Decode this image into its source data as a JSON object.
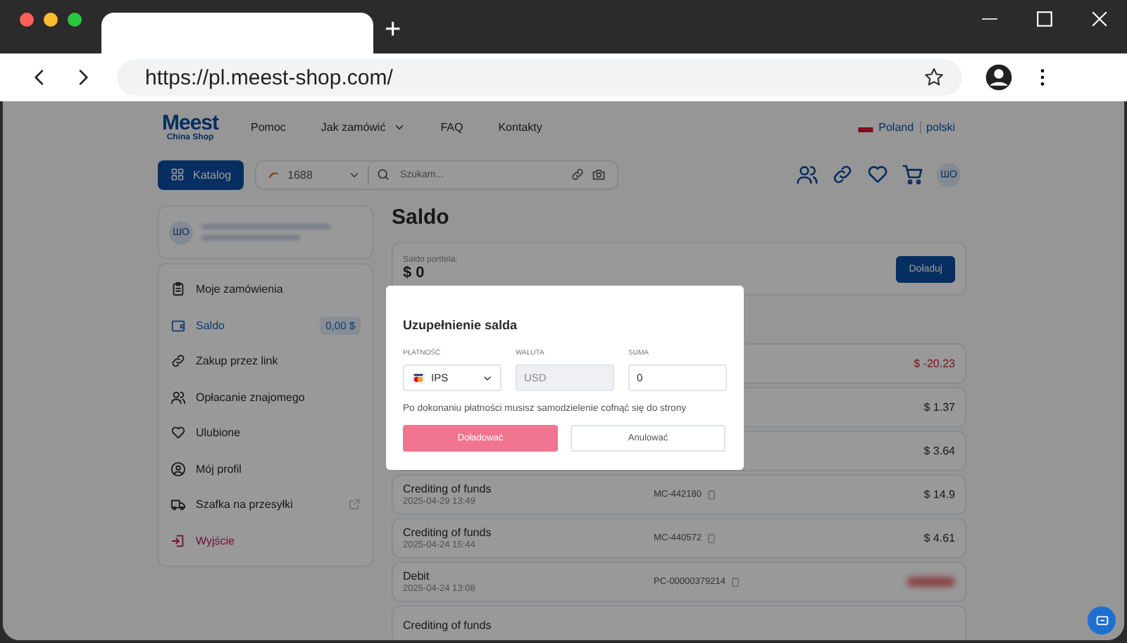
{
  "browser": {
    "new_tab": "+",
    "url": "https://pl.meest-shop.com/"
  },
  "header": {
    "logo": "Meest",
    "logo_sub": "China Shop",
    "nav": [
      {
        "label": "Pomoc",
        "dropdown": false
      },
      {
        "label": "Jak zamówić",
        "dropdown": true
      },
      {
        "label": "FAQ",
        "dropdown": false
      },
      {
        "label": "Kontakty",
        "dropdown": false
      }
    ],
    "country": "Poland",
    "language": "polski",
    "catalog_button": "Katalog",
    "source": "1688",
    "search": {
      "placeholder": "Szukam..."
    },
    "avatar": "ШО"
  },
  "sidebar": {
    "avatar": "ШО",
    "items": [
      {
        "label": "Moje zamówienia",
        "selected": false,
        "kind": "normal"
      },
      {
        "label": "Saldo",
        "selected": true,
        "kind": "normal",
        "badge": "0,00 $"
      },
      {
        "label": "Zakup przez link",
        "selected": false,
        "kind": "normal"
      },
      {
        "label": "Opłacanie znajomego",
        "selected": false,
        "kind": "normal"
      },
      {
        "label": "Ulubione",
        "selected": false,
        "kind": "normal"
      },
      {
        "label": "Mój profil",
        "selected": false,
        "kind": "normal"
      },
      {
        "label": "Szafka na przesyłki",
        "selected": false,
        "kind": "external"
      },
      {
        "label": "Wyjście",
        "selected": false,
        "kind": "logout"
      }
    ]
  },
  "main": {
    "title": "Saldo",
    "wallet": {
      "label": "Saldo portfela:",
      "amount": "$ 0",
      "button": "Doładuj"
    },
    "transactions": [
      {
        "kind": "debit",
        "amount": "$ -20.23"
      },
      {
        "kind": "credit",
        "amount": "$ 1.37"
      },
      {
        "kind": "credit",
        "amount": "$ 3.64"
      },
      {
        "kind": "credit",
        "title": "Crediting of funds",
        "date": "2025-04-29 13:49",
        "ref": "MC-442180",
        "amount": "$ 14.9"
      },
      {
        "kind": "credit",
        "title": "Crediting of funds",
        "date": "2025-04-24 15:44",
        "ref": "MC-440572",
        "amount": "$ 4.61"
      },
      {
        "kind": "debit",
        "title": "Debit",
        "date": "2025-04-24 13:08",
        "ref": "PC-00000379214"
      },
      {
        "title": "Crediting of funds"
      }
    ]
  },
  "modal": {
    "title": "Uzupełnienie salda",
    "fields": [
      {
        "label": "PŁATNOŚĆ",
        "kind": "select",
        "value": "IPS"
      },
      {
        "label": "WALUTA",
        "kind": "readonly",
        "value": "USD"
      },
      {
        "label": "SUMA",
        "kind": "input",
        "value": "0"
      }
    ],
    "note": "Po dokonaniu płatności musisz samodzielenie cofnąć się do strony",
    "buttons": [
      {
        "label": "Doładować",
        "kind": "primary"
      },
      {
        "label": "Anulować",
        "kind": "secondary"
      }
    ]
  }
}
